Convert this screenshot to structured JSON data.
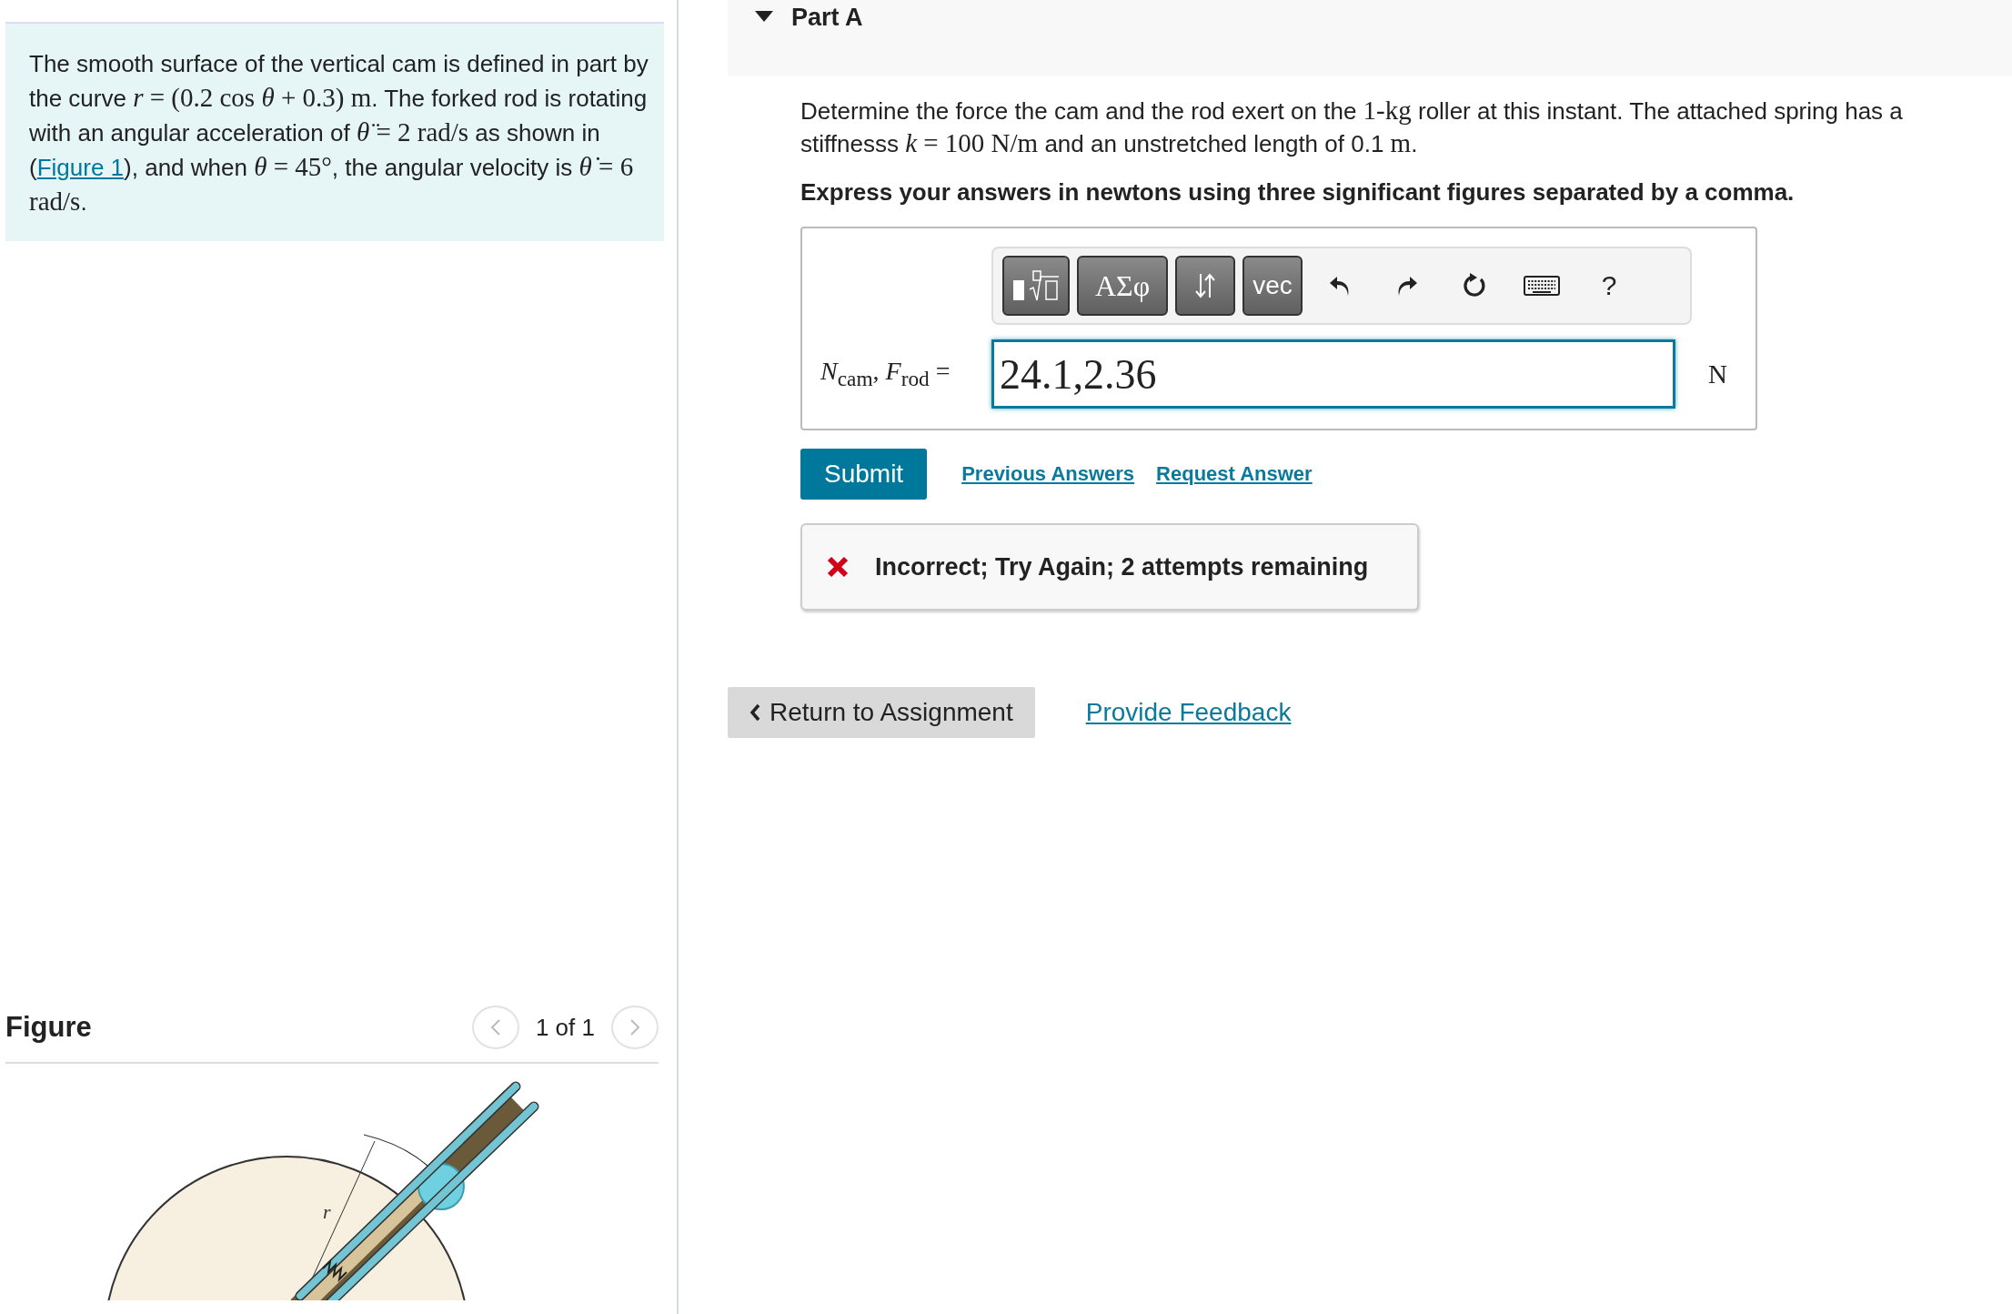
{
  "problem": {
    "segments": [
      {
        "kind": "text",
        "text": "The smooth surface of the vertical cam is defined in part by the curve "
      },
      {
        "kind": "math",
        "text": "*r* = (0.2 cos *θ* + 0.3) m"
      },
      {
        "kind": "text",
        "text": ". The forked rod is rotating with an angular acceleration of "
      },
      {
        "kind": "math",
        "text": "*θ̈* = 2 rad/s"
      },
      {
        "kind": "text",
        "text": " as shown in ("
      },
      {
        "kind": "link",
        "text": "Figure 1"
      },
      {
        "kind": "text",
        "text": "), and when "
      },
      {
        "kind": "math",
        "text": "*θ* = 45°"
      },
      {
        "kind": "text",
        "text": ", the angular velocity is "
      },
      {
        "kind": "math",
        "text": "*θ̇* = 6 rad/s"
      },
      {
        "kind": "text",
        "text": "."
      }
    ]
  },
  "figure": {
    "title": "Figure",
    "pager": "1 of 1",
    "labels": [
      "r"
    ]
  },
  "part": {
    "title": "Part A",
    "expanded": true,
    "description": [
      {
        "kind": "text",
        "text": "Determine the force the cam and the rod exert on the "
      },
      {
        "kind": "math",
        "text": "1-kg"
      },
      {
        "kind": "text",
        "text": " roller at this instant. The attached spring has a stiffnesss "
      },
      {
        "kind": "math",
        "text": "*k* = 100 N/m"
      },
      {
        "kind": "text",
        "text": " and an unstretched length of 0.1 "
      },
      {
        "kind": "math",
        "text": "m"
      },
      {
        "kind": "text",
        "text": "."
      }
    ],
    "instruction": "Express your answers in newtons using three significant figures separated by a comma.",
    "toolbar": {
      "symbols_label": "ΑΣφ",
      "vector_label": "vec",
      "help_label": "?"
    },
    "answer_label": "*N*$_{cam}$, *F*$_{rod}$ =",
    "answer_value": "24.1,2.36",
    "unit": "N",
    "submit": "Submit",
    "links": [
      "Previous Answers",
      "Request Answer"
    ],
    "feedback": {
      "kind": "incorrect",
      "text": "Incorrect; Try Again; 2 attempts remaining"
    }
  },
  "footer": {
    "return_button": "Return to Assignment",
    "feedback_link": "Provide Feedback"
  }
}
